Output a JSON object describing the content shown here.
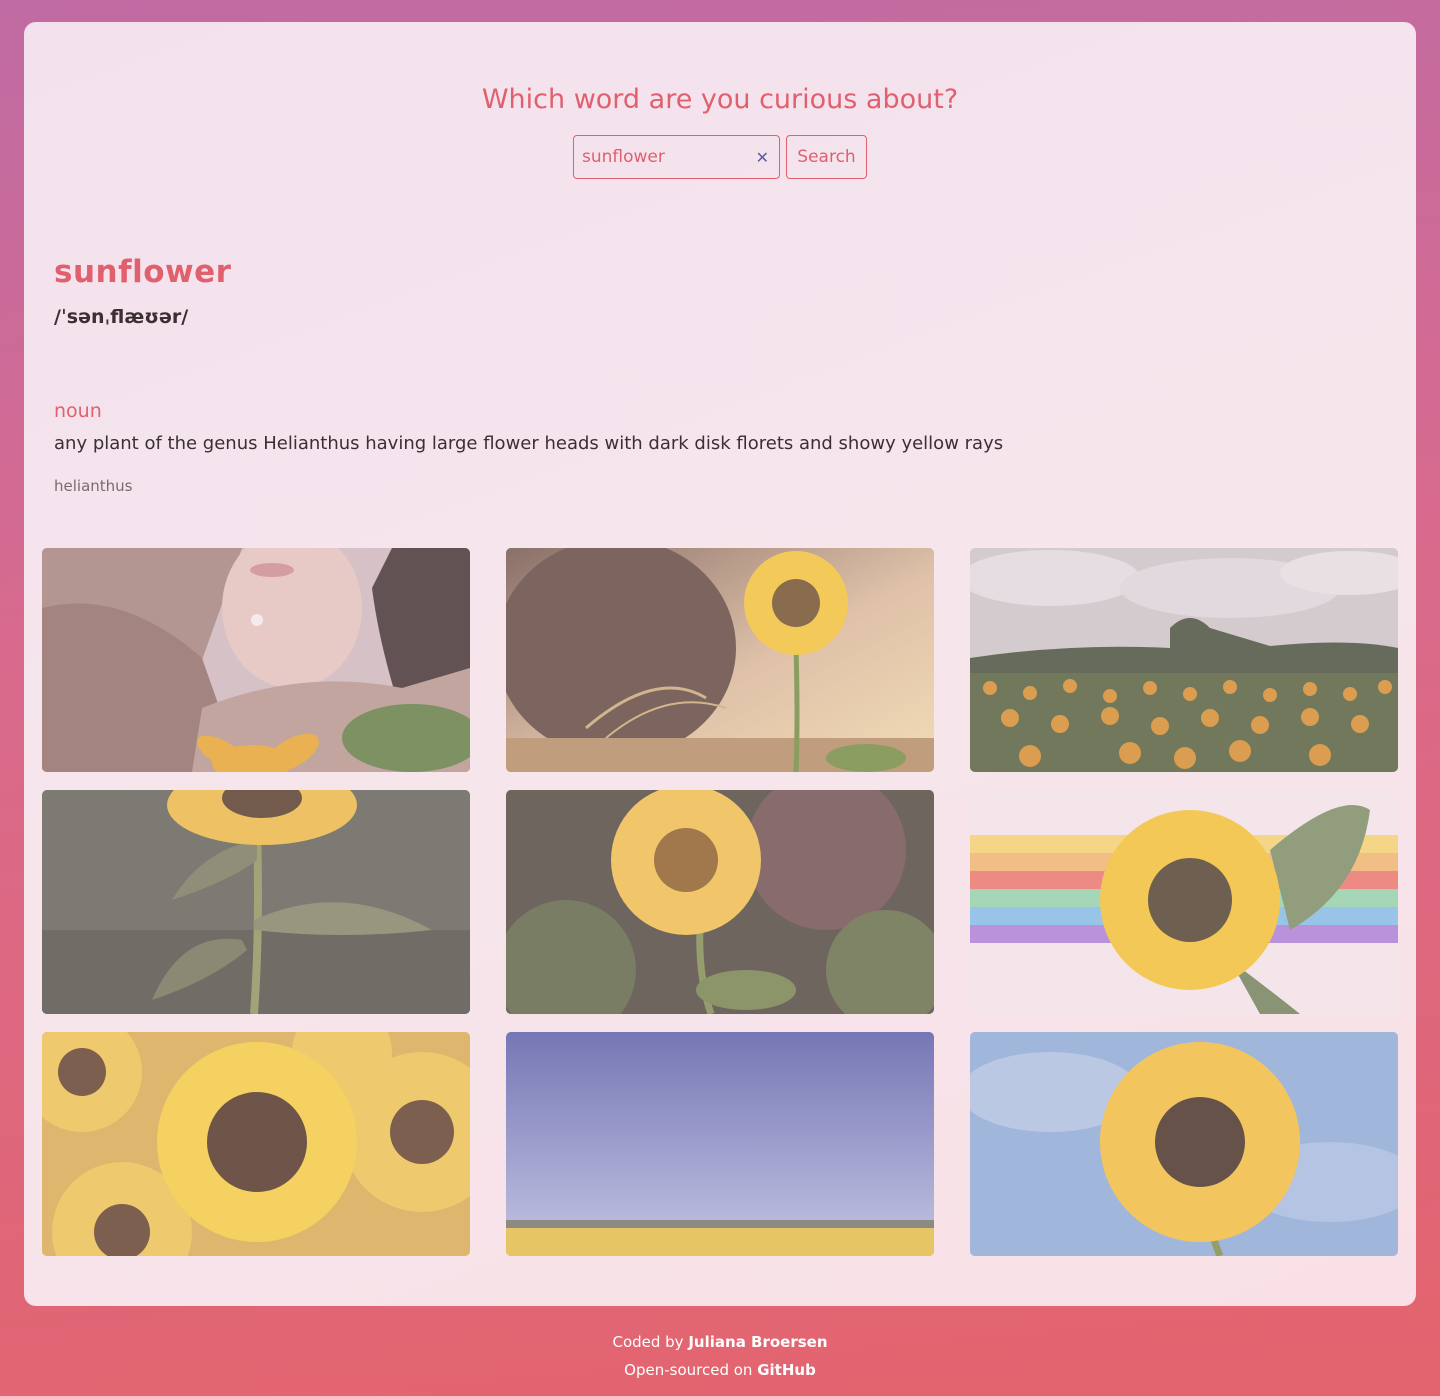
{
  "header": {
    "question": "Which word are you curious about?"
  },
  "search": {
    "value": "sunflower",
    "button_label": "Search",
    "clear_icon": "close-icon"
  },
  "result": {
    "word": "sunflower",
    "phonetic": "/ˈsənˌflæʊər/",
    "meanings": [
      {
        "part_of_speech": "noun",
        "definition": "any plant of the genus Helianthus having large flower heads with dark disk florets and showy yellow rays",
        "synonyms": "helianthus"
      }
    ]
  },
  "gallery": {
    "photos": [
      "photo-woman-with-sunflower",
      "photo-sunflower-at-sunset",
      "photo-sunflower-field-clouds",
      "photo-sunflower-stem-dark",
      "photo-sunflower-closeup-bokeh",
      "photo-sunflower-on-rainbow",
      "photo-sunflowers-crowd",
      "photo-field-under-blue-sky",
      "photo-sunflower-blue-sky"
    ]
  },
  "footer": {
    "coded_by_prefix": "Coded by",
    "author": "Juliana Broersen",
    "open_source_prefix": "Open-sourced on",
    "github_link": "GitHub"
  },
  "colors": {
    "accent": "#e0606e",
    "text": "#3b2f33",
    "muted": "#7a6a70"
  }
}
